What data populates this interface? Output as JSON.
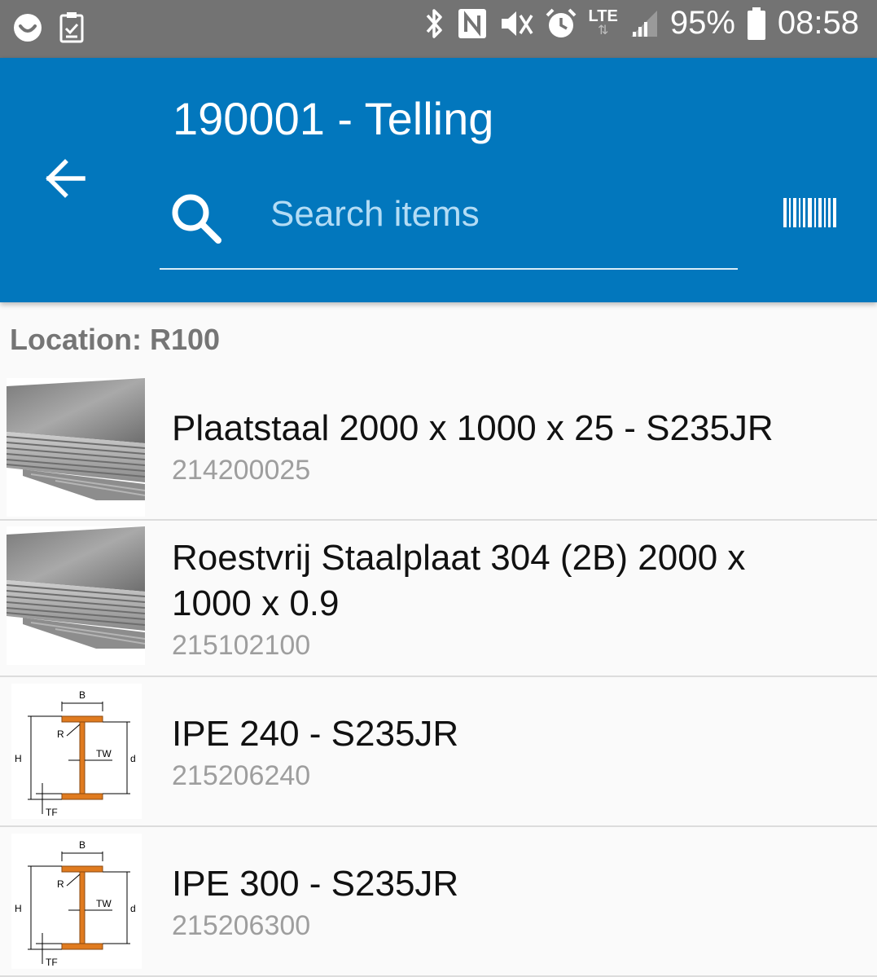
{
  "status_bar": {
    "battery": "95%",
    "time": "08:58",
    "network": "LTE",
    "icons": [
      "smiley-icon",
      "task-check-icon",
      "bluetooth-icon",
      "nfc-icon",
      "mute-icon",
      "alarm-icon",
      "lte-icon",
      "signal-icon",
      "battery-icon"
    ]
  },
  "header": {
    "title": "190001 - Telling",
    "search_placeholder": "Search items",
    "color": "#0277bd"
  },
  "location_label": "Location: R100",
  "items": [
    {
      "name": "Plaatstaal 2000 x 1000 x 25 - S235JR",
      "code": "214200025",
      "image": "steel-plate"
    },
    {
      "name": "Roestvrij Staalplaat 304 (2B) 2000 x 1000 x 0.9",
      "code": "215102100",
      "image": "steel-plate"
    },
    {
      "name": "IPE 240 - S235JR",
      "code": "215206240",
      "image": "ipe-profile"
    },
    {
      "name": "IPE 300 - S235JR",
      "code": "215206300",
      "image": "ipe-profile"
    }
  ],
  "ipe_diagram_labels": {
    "b": "B",
    "h": "H",
    "r": "R",
    "tw": "TW",
    "d": "d",
    "tf": "TF"
  }
}
